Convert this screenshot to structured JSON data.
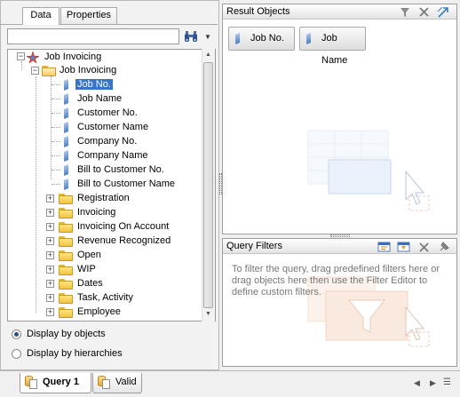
{
  "left_panel": {
    "tabs": [
      "Data",
      "Properties"
    ],
    "search": {
      "value": "",
      "placeholder": ""
    },
    "tree": {
      "root": "Job Invoicing",
      "folder": "Job Invoicing",
      "fields": [
        "Job No.",
        "Job Name",
        "Customer No.",
        "Customer Name",
        "Company No.",
        "Company Name",
        "Bill to Customer No.",
        "Bill to Customer Name"
      ],
      "selected_field": "Job No.",
      "subfolders": [
        "Registration",
        "Invoicing",
        "Invoicing On Account",
        "Revenue Recognized",
        "Open",
        "WIP",
        "Dates",
        "Task, Activity",
        "Employee"
      ]
    },
    "display_options": [
      {
        "label": "Display by objects",
        "selected": true
      },
      {
        "label": "Display by hierarchies",
        "selected": false
      }
    ]
  },
  "result_objects": {
    "title": "Result Objects",
    "items": [
      "Job No.",
      "Job Name"
    ]
  },
  "query_filters": {
    "title": "Query Filters",
    "hint": "To filter the query, drag predefined filters here or drag objects here then use the Filter Editor to define custom filters."
  },
  "bottom_tabs": [
    {
      "label": "Query 1",
      "active": true
    },
    {
      "label": "Valid",
      "active": false
    }
  ],
  "colors": {
    "selection": "#3b73c7",
    "folder": "#f0c43c",
    "field_icon": "#4d7fc5"
  }
}
